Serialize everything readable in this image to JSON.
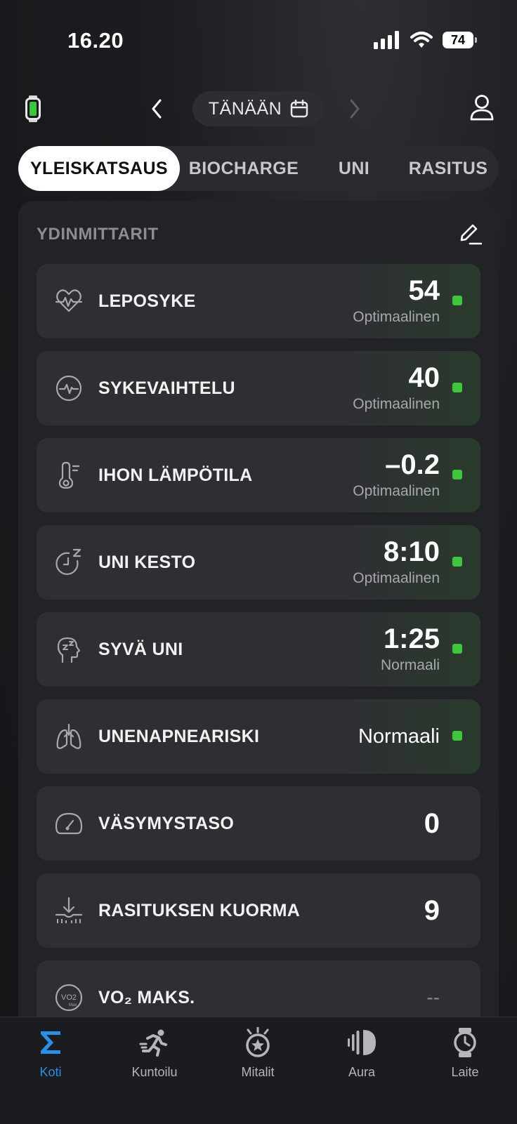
{
  "status_bar": {
    "time": "16.20",
    "battery": "74"
  },
  "top_nav": {
    "date_label": "TÄNÄÄN"
  },
  "tabs": [
    {
      "label": "YLEISKATSAUS",
      "active": true
    },
    {
      "label": "BIOCHARGE",
      "active": false
    },
    {
      "label": "UNI",
      "active": false
    },
    {
      "label": "RASITUS",
      "active": false
    }
  ],
  "panel": {
    "title": "YDINMITTARIT",
    "metrics": [
      {
        "label": "LEPOSYKE",
        "value": "54",
        "status": "Optimaalinen",
        "icon": "heartbeat-wave-icon",
        "indicator": "green"
      },
      {
        "label": "SYKEVAIHTELU",
        "value": "40",
        "status": "Optimaalinen",
        "icon": "hrv-circle-icon",
        "indicator": "green"
      },
      {
        "label": "IHON LÄMPÖTILA",
        "value": "–0.2",
        "status": "Optimaalinen",
        "icon": "thermometer-icon",
        "indicator": "green"
      },
      {
        "label": "UNI KESTO",
        "value": "8:10",
        "status": "Optimaalinen",
        "icon": "sleep-clock-icon",
        "indicator": "green"
      },
      {
        "label": "SYVÄ UNI",
        "value": "1:25",
        "status": "Normaali",
        "icon": "deep-sleep-head-icon",
        "indicator": "green"
      },
      {
        "label": "UNENAPNEARISKI",
        "value": "Normaali",
        "status": "",
        "icon": "lungs-icon",
        "indicator": "green"
      },
      {
        "label": "VÄSYMYSTASO",
        "value": "0",
        "status": "",
        "icon": "gauge-icon",
        "indicator": "none"
      },
      {
        "label": "RASITUKSEN KUORMA",
        "value": "9",
        "status": "",
        "icon": "load-arrow-icon",
        "indicator": "none"
      },
      {
        "label": "VO₂ MAKS.",
        "value": "--",
        "status": "",
        "icon": "vo2max-icon",
        "indicator": "none"
      }
    ]
  },
  "bottom_nav": [
    {
      "label": "Koti",
      "icon": "sigma-icon",
      "active": true
    },
    {
      "label": "Kuntoilu",
      "icon": "runner-icon",
      "active": false
    },
    {
      "label": "Mitalit",
      "icon": "medal-icon",
      "active": false
    },
    {
      "label": "Aura",
      "icon": "aura-icon",
      "active": false
    },
    {
      "label": "Laite",
      "icon": "watch-icon",
      "active": false
    }
  ],
  "colors": {
    "accent": "#2a8fe6",
    "good": "#3dc63d",
    "background": "#1c1d20",
    "card": "#2e2f33"
  }
}
